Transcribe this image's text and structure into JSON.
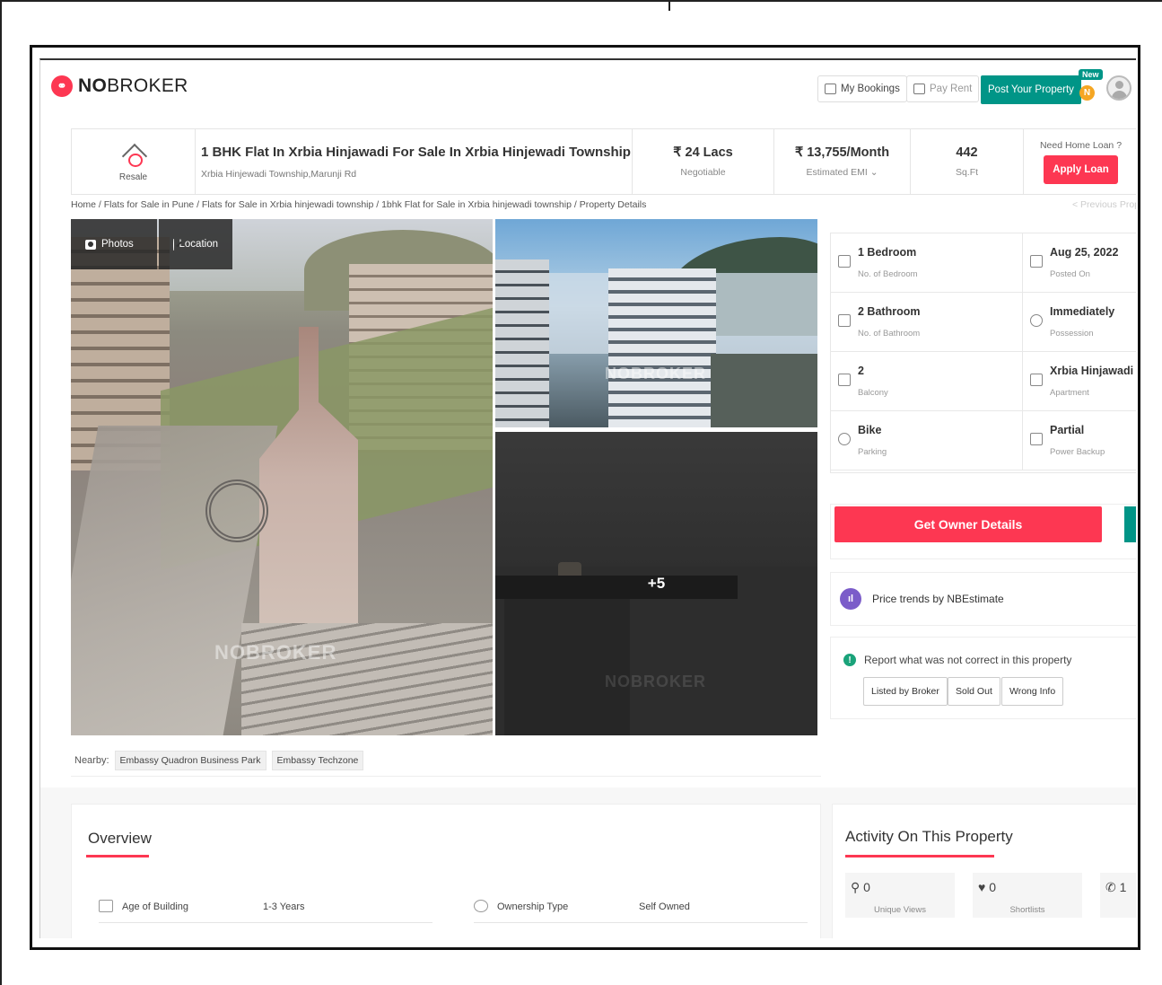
{
  "header": {
    "logo_prefix": "NO",
    "logo_suffix": "BROKER",
    "my_bookings": "My Bookings",
    "pay_rent": "Pay Rent",
    "post_property": "Post Your Property",
    "new_badge": "New",
    "coin_letter": "N"
  },
  "property": {
    "type_label": "Resale",
    "title": "1 BHK Flat In Xrbia Hinjawadi For Sale In Xrbia Hinjewadi Township",
    "subtitle": "Xrbia Hinjewadi Township,Marunji Rd",
    "price": "₹ 24 Lacs",
    "price_note": "Negotiable",
    "emi": "₹ 13,755/Month",
    "emi_label": "Estimated EMI ⌄",
    "area": "442",
    "area_unit": "Sq.Ft",
    "loan_question": "Need Home Loan ?",
    "apply_loan": "Apply Loan"
  },
  "breadcrumb": "Home / Flats for Sale in Pune / Flats for Sale in Xrbia hinjewadi township / 1bhk Flat for Sale in Xrbia hinjewadi township / Property Details",
  "previous_property": "< Previous Prop",
  "gallery": {
    "photos_btn": "Photos",
    "location_btn": "Location",
    "more_count": "+5",
    "watermark": "NOBROKER"
  },
  "nearby": {
    "label": "Nearby:",
    "places": [
      "Embassy Quadron Business Park",
      "Embassy Techzone"
    ]
  },
  "details": [
    {
      "value": "1 Bedroom",
      "label": "No. of Bedroom"
    },
    {
      "value": "Aug 25, 2022",
      "label": "Posted On"
    },
    {
      "value": "2 Bathroom",
      "label": "No. of Bathroom"
    },
    {
      "value": "Immediately",
      "label": "Possession"
    },
    {
      "value": "2",
      "label": "Balcony"
    },
    {
      "value": "Xrbia Hinjawadi",
      "label": "Apartment"
    },
    {
      "value": "Bike",
      "label": "Parking"
    },
    {
      "value": "Partial",
      "label": "Power Backup"
    }
  ],
  "cta": {
    "owner_details": "Get Owner Details"
  },
  "price_trends": "Price trends by NBEstimate",
  "report": {
    "text": "Report what was not correct in this property",
    "options": [
      "Listed by Broker",
      "Sold Out",
      "Wrong Info"
    ]
  },
  "overview": {
    "title": "Overview",
    "rows": [
      {
        "label": "Age of Building",
        "value": "1-3 Years"
      },
      {
        "label": "Ownership Type",
        "value": "Self Owned"
      }
    ]
  },
  "activity": {
    "title": "Activity On This Property",
    "stats": [
      {
        "icon": "person-icon",
        "value": "0",
        "label": "Unique Views"
      },
      {
        "icon": "heart-icon",
        "value": "0",
        "label": "Shortlists"
      },
      {
        "icon": "phone-icon",
        "value": "1",
        "label": ""
      }
    ]
  },
  "colors": {
    "brand_red": "#fd3752",
    "teal": "#009587",
    "purple": "#7b5cc9"
  }
}
